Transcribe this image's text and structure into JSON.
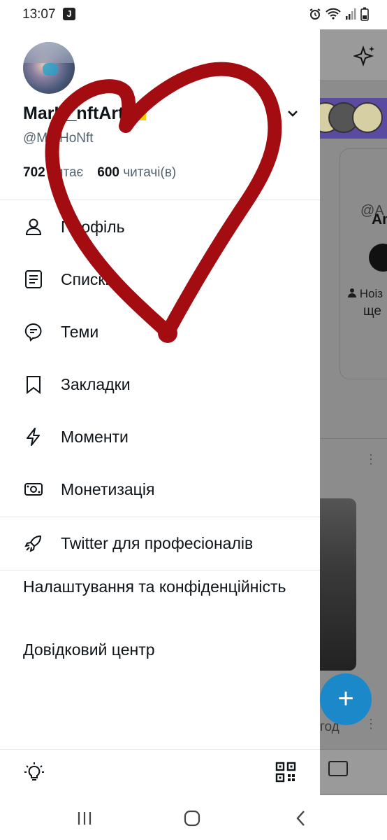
{
  "status_bar": {
    "time": "13:07",
    "app_icon_letter": "J",
    "icons": [
      "alarm-icon",
      "wifi-icon",
      "signal-icon",
      "battery-icon"
    ]
  },
  "profile": {
    "display_name": "MarH_nftArt",
    "handle": "@MarHoNft",
    "following_count": "702",
    "following_label": "читає",
    "followers_count": "600",
    "followers_label": "читачі(в)"
  },
  "menu": {
    "items": [
      {
        "label": "Профіль",
        "icon": "person-icon"
      },
      {
        "label": "Списки",
        "icon": "list-icon"
      },
      {
        "label": "Теми",
        "icon": "topics-icon"
      },
      {
        "label": "Закладки",
        "icon": "bookmark-icon"
      },
      {
        "label": "Моменти",
        "icon": "lightning-icon"
      },
      {
        "label": "Монетизація",
        "icon": "money-icon"
      }
    ],
    "professional": {
      "label": "Twitter для професіоналів",
      "icon": "rocket-icon"
    },
    "settings_label": "Налаштування та конфіденційність",
    "help_label": "Довідковий центр"
  },
  "background_app": {
    "name_fragment": "An",
    "handle_fragment": "@A",
    "text_line1": "Ноіз",
    "text_line2": "ще",
    "time_fragment": "год"
  },
  "colors": {
    "accent": "#1d9bf0",
    "heart": "#a30d12",
    "muted_text": "#536471"
  }
}
